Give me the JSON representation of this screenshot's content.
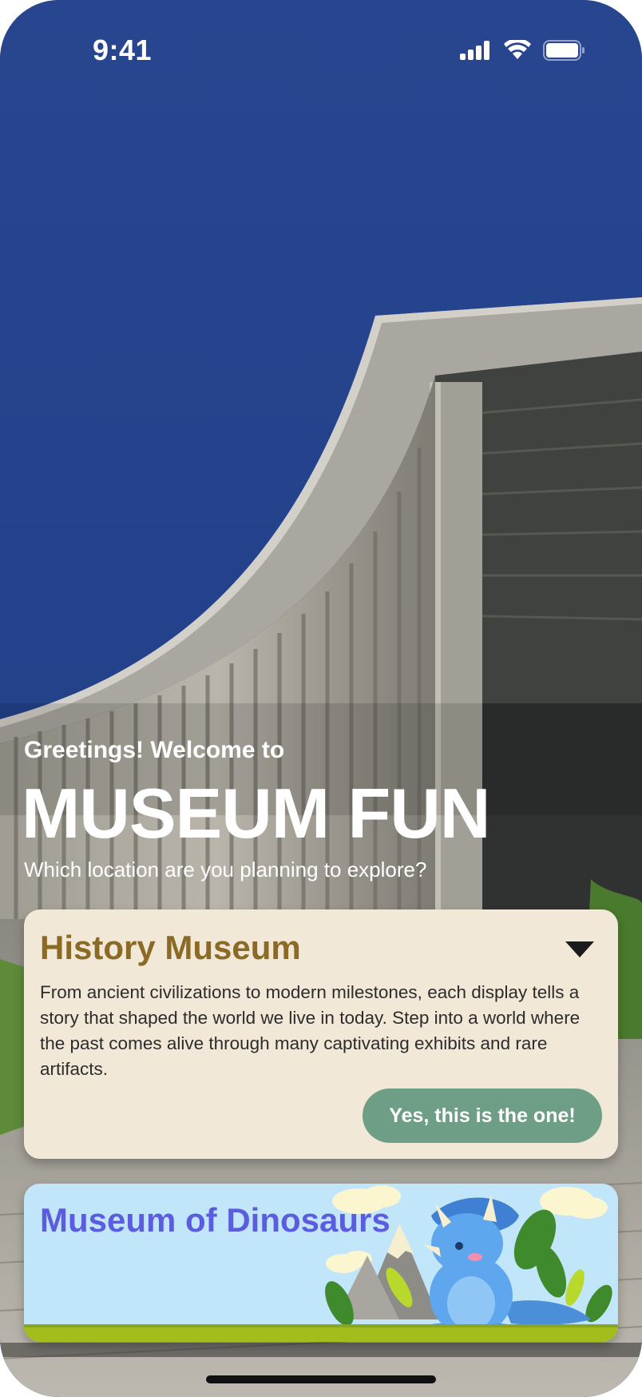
{
  "status_bar": {
    "time": "9:41"
  },
  "hero": {
    "greeting": "Greetings! Welcome to",
    "title": "MUSEUM FUN",
    "question": "Which location are you planning to explore?"
  },
  "museums": [
    {
      "name": "History Museum",
      "expanded": true,
      "description": "From ancient civilizations to modern milestones, each display tells a story that shaped the world we live in today. Step into a world where the past comes alive through many captivating exhibits and rare artifacts.",
      "cta_label": "Yes, this is the one!"
    },
    {
      "name": "Museum of Dinosaurs",
      "expanded": false
    }
  ],
  "colors": {
    "sky": "#28468f",
    "history_card": "#f2e8d7",
    "history_title": "#8a6a24",
    "cta": "#6f9e86",
    "dino_card": "#c2e6f9",
    "dino_title": "#5c5ce0"
  }
}
